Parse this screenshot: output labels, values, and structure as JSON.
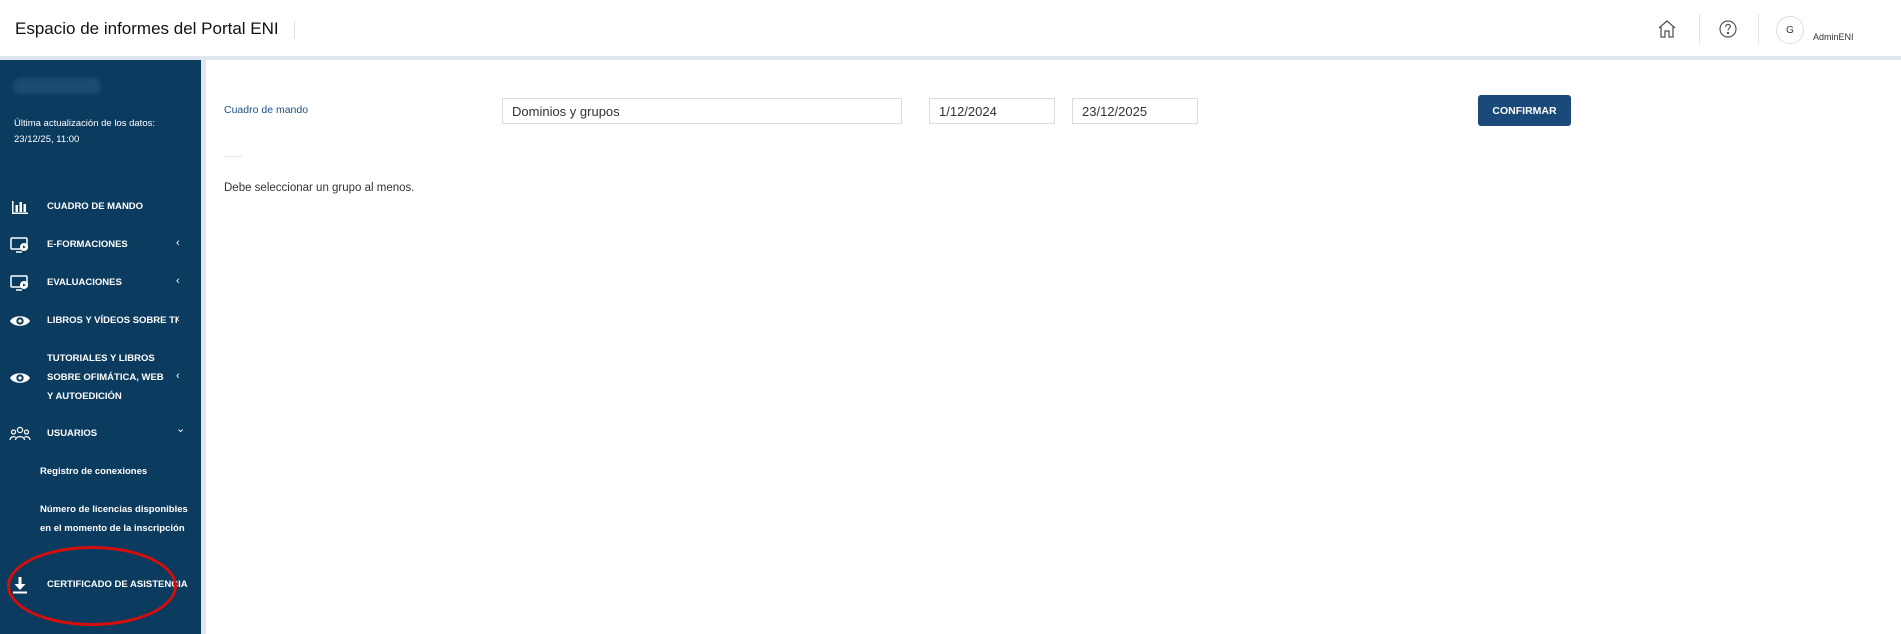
{
  "header": {
    "title": "Espacio de informes del Portal ENI",
    "icons": [
      "home-icon",
      "help-icon"
    ],
    "avatar_initial": "G",
    "user_name": "AdminENI"
  },
  "sidebar": {
    "update_label": "Última actualización de los datos:",
    "update_time": "23/12/25, 11:00",
    "items": [
      {
        "label": "CUADRO DE MANDO",
        "icon": "bar-chart-icon",
        "chevron": ""
      },
      {
        "label": "E-FORMACIONES",
        "icon": "monitor-play-icon",
        "chevron": "‹"
      },
      {
        "label": "EVALUACIONES",
        "icon": "monitor-play-icon",
        "chevron": "‹"
      },
      {
        "label": "LIBROS Y VÍDEOS SOBRE TI",
        "icon": "eye-icon",
        "chevron": "‹"
      },
      {
        "label": "TUTORIALES Y LIBROS SOBRE OFIMÁTICA, WEB Y AUTOEDICIÓN",
        "icon": "eye-icon",
        "chevron": "‹"
      },
      {
        "label": "USUARIOS",
        "icon": "users-icon",
        "chevron": "⌄"
      },
      {
        "label": "CERTIFICADO DE ASISTENCIA",
        "icon": "download-icon",
        "chevron": ""
      }
    ],
    "sub_items": [
      {
        "label": "Registro de conexiones"
      },
      {
        "label": "Número de licencias disponibles en el momento de la inscripción"
      }
    ]
  },
  "main": {
    "breadcrumb": "Cuadro de mando",
    "group_select": "Dominios y grupos",
    "date_from": "1/12/2024",
    "date_to": "23/12/2025",
    "confirm_label": "CONFIRMAR",
    "message": "Debe seleccionar un grupo al menos."
  },
  "colors": {
    "sidebar_bg": "#0b3b5f",
    "confirm_bg": "#1a4a7a",
    "link": "#1a4f86",
    "highlight_ellipse": "#d60d0d"
  }
}
